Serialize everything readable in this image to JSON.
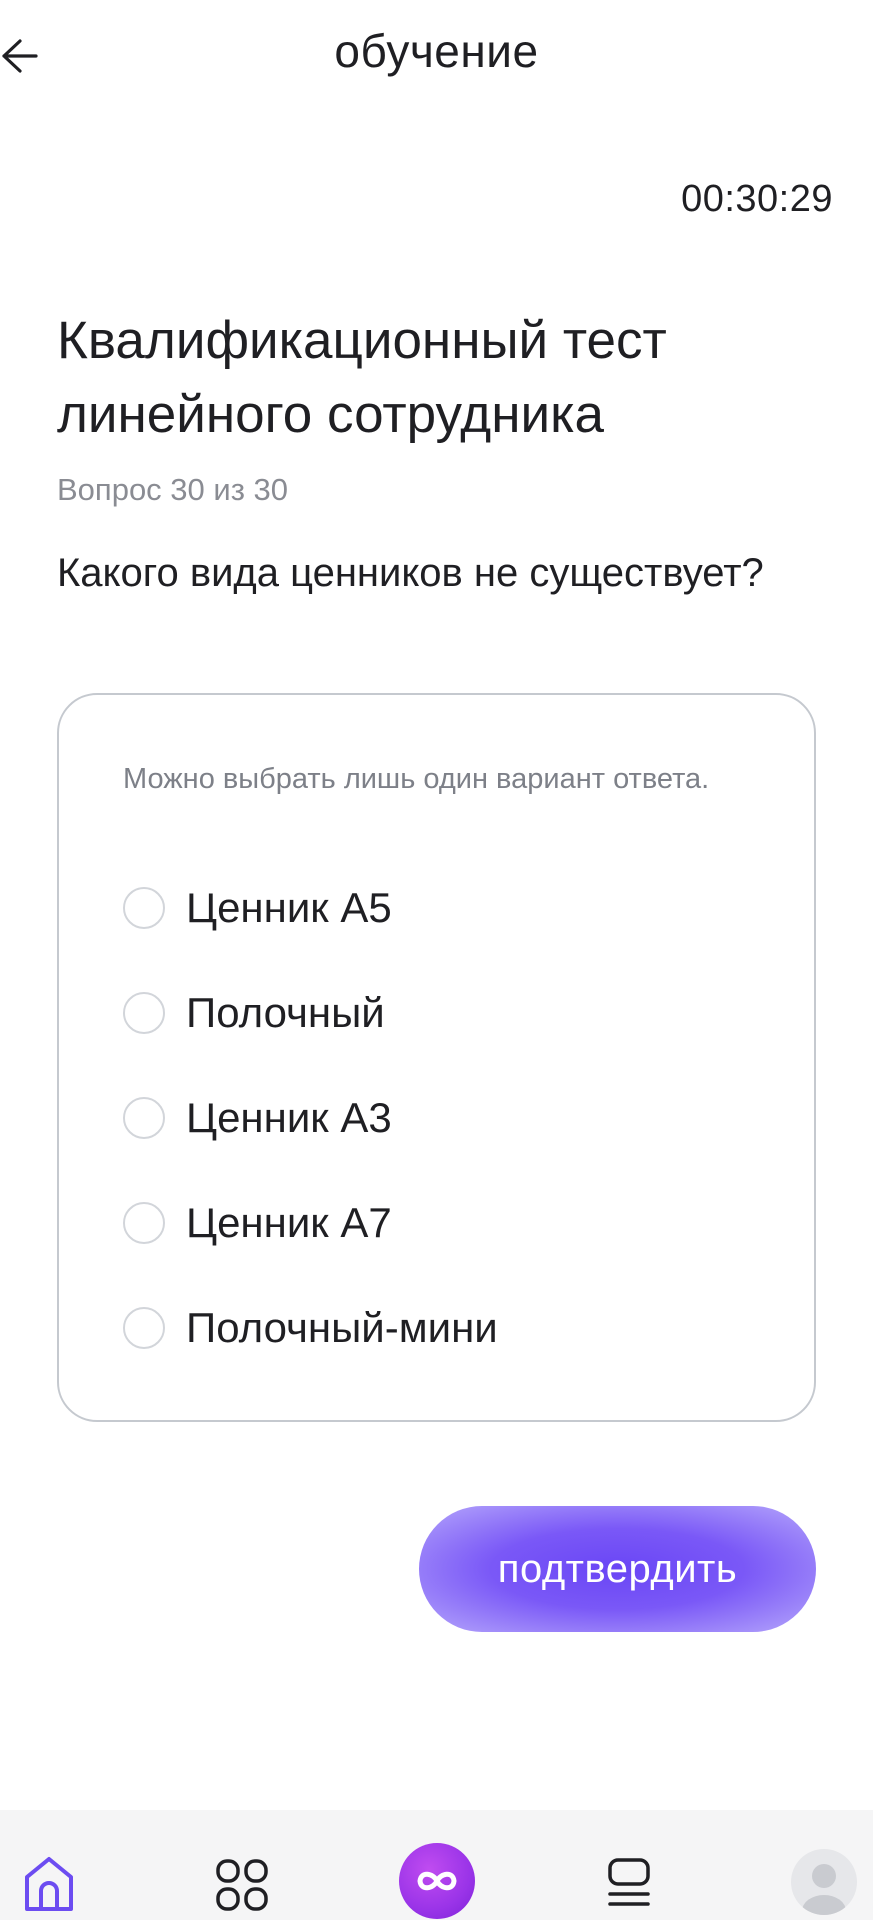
{
  "header": {
    "title": "обучение"
  },
  "timer": "00:30:29",
  "test": {
    "title": "Квалификационный тест линейного сотрудника",
    "question_count": "Вопрос 30 из 30",
    "question": "Какого вида ценников не существует?"
  },
  "answers": {
    "hint": "Можно выбрать лишь один вариант ответа.",
    "options": [
      {
        "label": "Ценник А5"
      },
      {
        "label": "Полочный"
      },
      {
        "label": "Ценник А3"
      },
      {
        "label": "Ценник А7"
      },
      {
        "label": "Полочный-мини"
      }
    ]
  },
  "confirm_button": {
    "label": "подтвердить"
  },
  "bottom_nav": {
    "items": [
      {
        "icon": "home-icon"
      },
      {
        "icon": "grid-icon"
      },
      {
        "icon": "infinity-icon"
      },
      {
        "icon": "list-icon"
      },
      {
        "icon": "avatar-icon"
      }
    ]
  },
  "colors": {
    "accent": "#6a46f5",
    "accent_light": "#b6a6fb",
    "center_nav": "#9a34e8",
    "home_icon": "#6c4cf1",
    "text": "#1f1f23",
    "muted": "#8a8c93",
    "border": "#c5c9cf"
  }
}
